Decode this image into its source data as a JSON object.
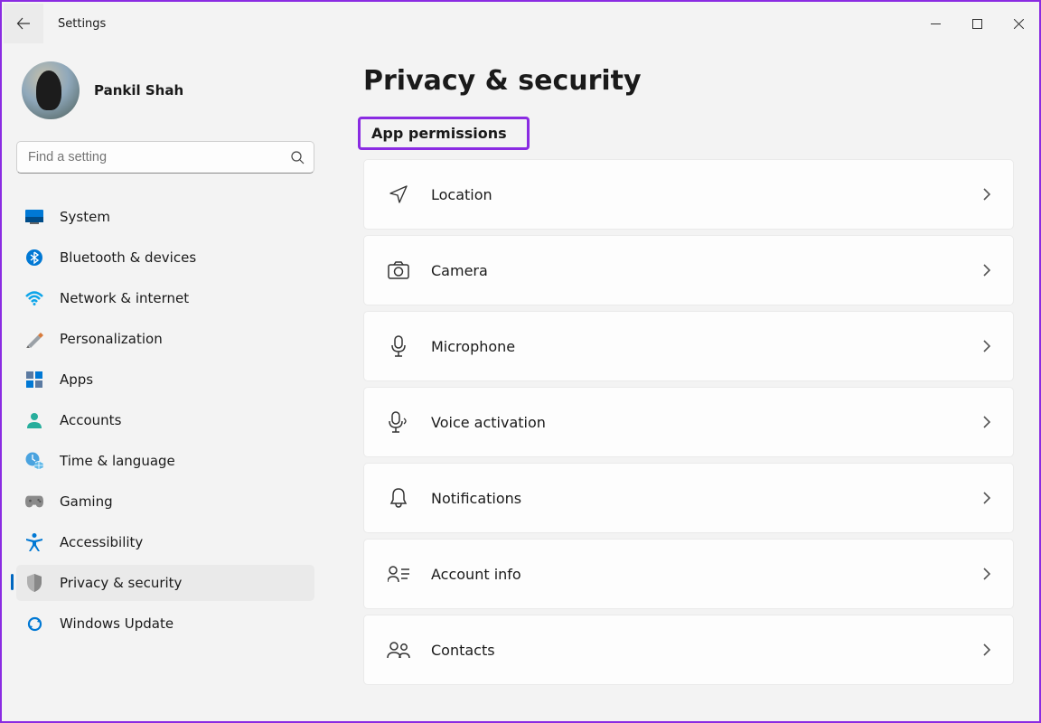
{
  "window": {
    "title": "Settings"
  },
  "profile": {
    "name": "Pankil Shah"
  },
  "search": {
    "placeholder": "Find a setting"
  },
  "nav": {
    "items": [
      {
        "id": "system",
        "label": "System"
      },
      {
        "id": "bluetooth",
        "label": "Bluetooth & devices"
      },
      {
        "id": "network",
        "label": "Network & internet"
      },
      {
        "id": "personalization",
        "label": "Personalization"
      },
      {
        "id": "apps",
        "label": "Apps"
      },
      {
        "id": "accounts",
        "label": "Accounts"
      },
      {
        "id": "time",
        "label": "Time & language"
      },
      {
        "id": "gaming",
        "label": "Gaming"
      },
      {
        "id": "accessibility",
        "label": "Accessibility"
      },
      {
        "id": "privacy",
        "label": "Privacy & security"
      },
      {
        "id": "update",
        "label": "Windows Update"
      }
    ],
    "active": "privacy"
  },
  "page": {
    "title": "Privacy & security",
    "section_title": "App permissions",
    "permissions": [
      {
        "id": "location",
        "label": "Location"
      },
      {
        "id": "camera",
        "label": "Camera"
      },
      {
        "id": "microphone",
        "label": "Microphone"
      },
      {
        "id": "voice",
        "label": "Voice activation"
      },
      {
        "id": "notifications",
        "label": "Notifications"
      },
      {
        "id": "account-info",
        "label": "Account info"
      },
      {
        "id": "contacts",
        "label": "Contacts"
      }
    ]
  }
}
